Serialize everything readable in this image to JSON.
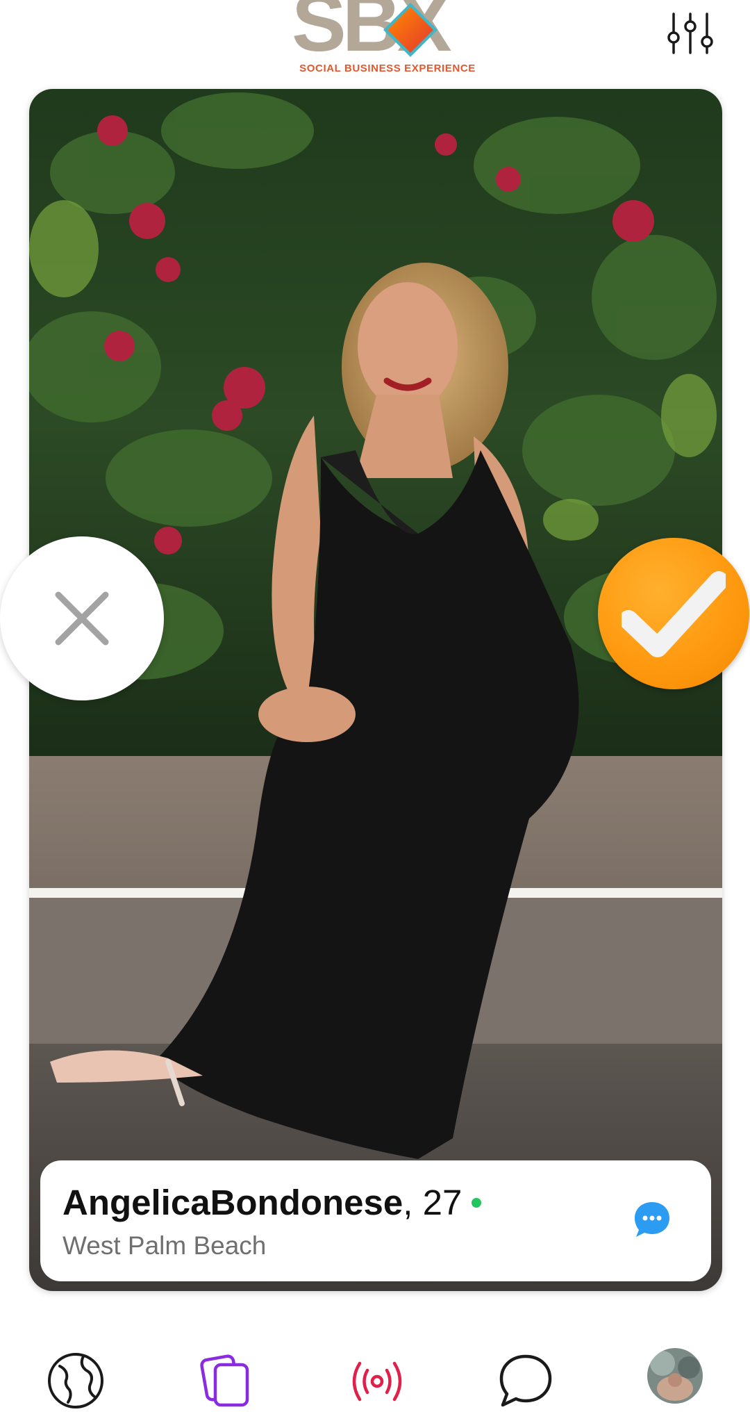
{
  "header": {
    "logo_text": "SBX",
    "logo_tagline": "SOCIAL BUSINESS EXPERIENCE",
    "logo_icon": "orange-diamond-logo-icon",
    "filter_icon": "sliders-icon"
  },
  "profile": {
    "name": "AngelicaBondonese",
    "age_text": ", 27",
    "location": "West Palm Beach",
    "online": true
  },
  "actions": {
    "reject_icon": "close-icon",
    "like_icon": "checkmark-icon",
    "message_icon": "chat-bubble-icon"
  },
  "nav": {
    "items": [
      {
        "id": "explore",
        "icon": "globe-icon",
        "active": false
      },
      {
        "id": "cards",
        "icon": "cards-icon",
        "active": true
      },
      {
        "id": "live",
        "icon": "broadcast-icon",
        "active": false
      },
      {
        "id": "chats",
        "icon": "speech-bubble-icon",
        "active": false
      },
      {
        "id": "profile",
        "icon": "avatar",
        "active": false
      }
    ]
  },
  "colors": {
    "accent_orange": "#FF9A10",
    "logo_grey": "#B3A898",
    "logo_red": "#E4572E",
    "active_nav": "#8A2BE2",
    "live_red": "#E0204A",
    "online_green": "#22C55E",
    "message_blue": "#2B9CF2"
  }
}
